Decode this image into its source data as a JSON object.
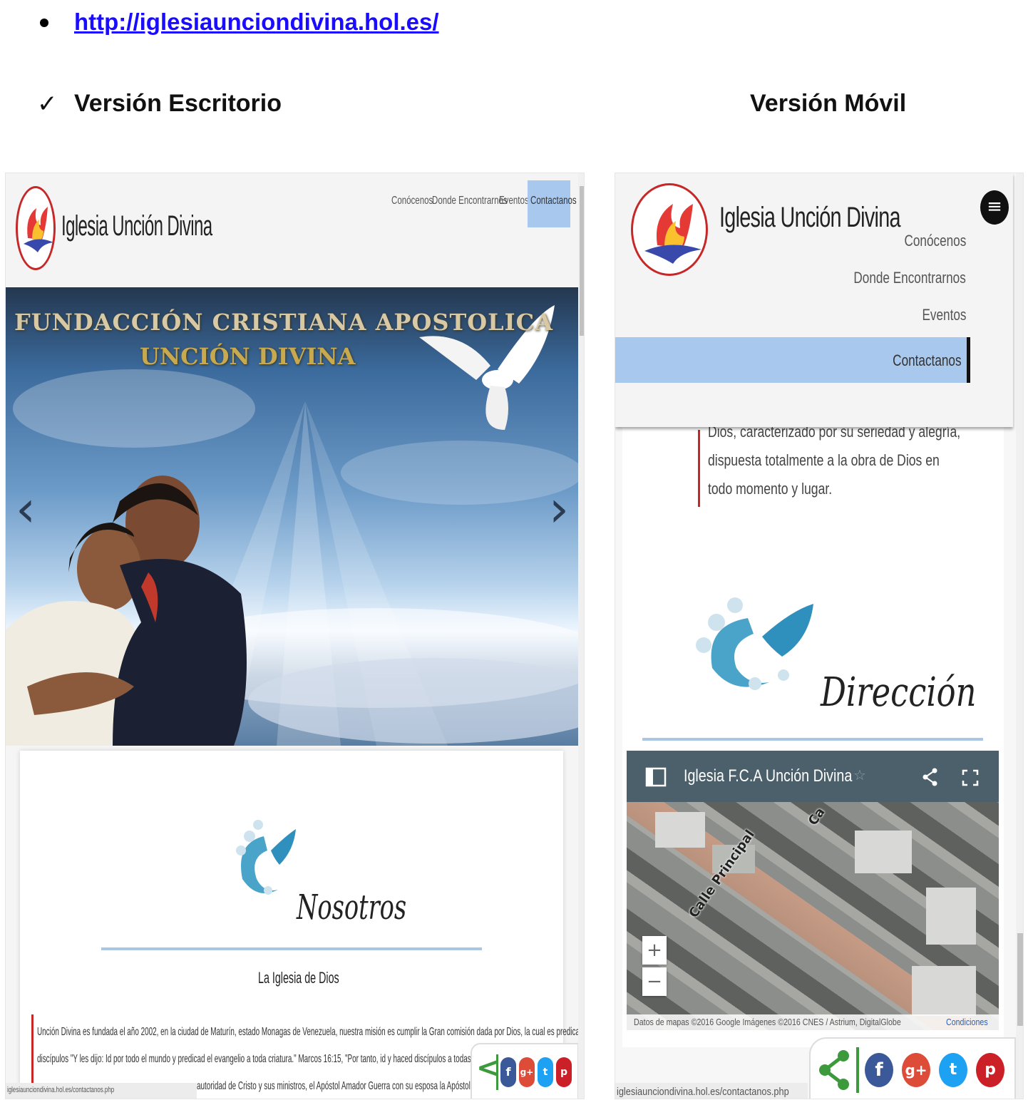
{
  "doc": {
    "url_link": "http://iglesiaunciondivina.hol.es/",
    "check_mark": "✓",
    "desktop_heading": "Versión Escritorio",
    "mobile_heading": "Versión Móvil"
  },
  "desktop": {
    "brand": "Iglesia Unción Divina",
    "nav": [
      "Conócenos",
      "Donde Encontrarnos",
      "Eventos",
      "Contactanos"
    ],
    "hero": {
      "title_line1": "FUNDACCIÓN CRISTIANA APOSTOLICA",
      "title_line2": "UNCIÓN DIVINA",
      "prev_arrow": "‹",
      "next_arrow": "›"
    },
    "section": {
      "title": "Nosotros",
      "subtitle": "La Iglesia de Dios",
      "paragraph": [
        "Unción Divina es fundada el año 2002, en la ciudad de Maturín, estado Monagas de Venezuela, nuestra misión es cumplir la Gran comisión dada por Dios, la cual es predicar y hacer",
        "discípulos \"Y les dijo: Id por todo el mundo y predicad el evangelio a toda criatura.\" Marcos 16:15, \"Por tanto, id y haced discípulos a todas las naciones, ba",
        "autoridad de Cristo y sus ministros, el Apóstol Amador Guerra con su esposa la Apóstol Mirca G"
      ]
    },
    "status_url": "iglesiaunciondivina.hol.es/contactanos.php"
  },
  "mobile": {
    "brand": "Iglesia Unción Divina",
    "menu_icon": "≡",
    "nav": [
      "Conócenos",
      "Donde Encontrarnos",
      "Eventos",
      "Contactanos"
    ],
    "paragraph": [
      "Dios, caracterizado por su seriedad y alegría,",
      "dispuesta totalmente a la obra de Dios en",
      "todo momento y lugar."
    ],
    "section_title": "Dirección",
    "map": {
      "title": "Iglesia F.C.A Unción Divina",
      "star": "☆",
      "street_label": "Calle Principal",
      "street_label_2": "Ca",
      "zoom_in": "+",
      "zoom_out": "−",
      "credit": "Datos de mapas ©2016 Google Imágenes ©2016 CNES / Astrium, DigitalGlobe",
      "terms": "Condiciones"
    },
    "status_url": "iglesiaunciondivina.hol.es/contactanos.php"
  },
  "social": {
    "facebook": "f",
    "googleplus": "g+",
    "twitter": "t",
    "pinterest": "p"
  },
  "colors": {
    "link": "#1a0dff",
    "nav_active_bg": "#a8c8ee",
    "accent_red": "#c62828",
    "rule_blue": "#a9c6e4",
    "share_green": "#3c9a3c"
  }
}
